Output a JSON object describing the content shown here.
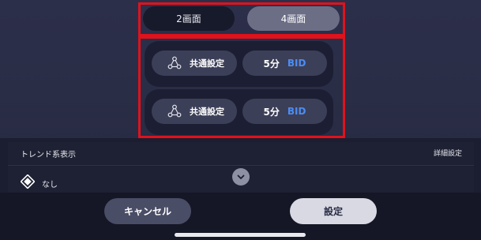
{
  "layout_toggle": {
    "option_2": "2画面",
    "option_4": "4画面",
    "selected": "4画面"
  },
  "panels": [
    {
      "setting_label": "共通設定",
      "interval": "5分",
      "price_type": "BID"
    },
    {
      "setting_label": "共通設定",
      "interval": "5分",
      "price_type": "BID"
    }
  ],
  "trend": {
    "section_label": "トレンド系表示",
    "detail_link": "詳細設定",
    "selected_value": "なし"
  },
  "footer": {
    "cancel_label": "キャンセル",
    "confirm_label": "設定"
  },
  "colors": {
    "highlight_border": "#e0121c",
    "bid_text": "#4d8cf0",
    "selected_segment": "#6c6e86"
  },
  "icons": {
    "common_setting": "three-node-network-icon",
    "trend_indicator": "diamond-icon",
    "expand": "chevron-down-icon"
  }
}
